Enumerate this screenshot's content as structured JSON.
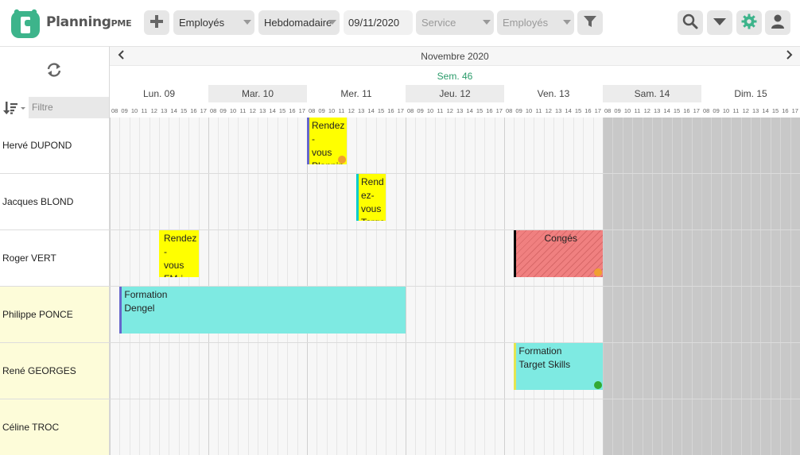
{
  "app": {
    "brand_main": "Planning",
    "brand_suffix": "PME",
    "colors": {
      "accent": "#2a9b6a",
      "logo": "#3db48b"
    }
  },
  "toolbar": {
    "add_icon": "plus-icon",
    "resource_select": "Employés",
    "view_select": "Hebdomadaire",
    "date_value": "09/11/2020",
    "service_select": "Service",
    "employees_select": "Employés",
    "filter_icon": "funnel-icon",
    "search_icon": "search-icon",
    "dropdown_icon": "triangle-down-icon",
    "settings_icon": "gear-icon",
    "user_icon": "user-icon"
  },
  "sidebar": {
    "refresh_icon": "refresh-icon",
    "sort_icon": "sort-icon",
    "filter_placeholder": "Filtre",
    "employees": [
      {
        "name": "Hervé DUPOND",
        "highlight": false
      },
      {
        "name": "Jacques BLOND",
        "highlight": false
      },
      {
        "name": "Roger VERT",
        "highlight": false
      },
      {
        "name": "Philippe PONCE",
        "highlight": true
      },
      {
        "name": "René GEORGES",
        "highlight": true
      },
      {
        "name": "Céline TROC",
        "highlight": true
      }
    ]
  },
  "calendar": {
    "prev_icon": "chevron-left-icon",
    "next_icon": "chevron-right-icon",
    "month": "Novembre 2020",
    "week": "Sem. 46",
    "days": [
      {
        "label": "Lun. 09",
        "weekend": false
      },
      {
        "label": "Mar. 10",
        "weekend": false
      },
      {
        "label": "Mer. 11",
        "weekend": false
      },
      {
        "label": "Jeu. 12",
        "weekend": false
      },
      {
        "label": "Ven. 13",
        "weekend": false
      },
      {
        "label": "Sam. 14",
        "weekend": true
      },
      {
        "label": "Dim. 15",
        "weekend": true
      }
    ],
    "hours": [
      "08",
      "09",
      "10",
      "11",
      "12",
      "13",
      "14",
      "15",
      "16",
      "17"
    ],
    "events": [
      {
        "row": 0,
        "day": 2,
        "start": 8,
        "end": 12,
        "text": "Rendez-\nvous\nPlanning\nCongés",
        "bg": "#ffff00",
        "bar": "#6666cc",
        "icon": "#f0a030"
      },
      {
        "row": 1,
        "day": 2,
        "start": 13,
        "end": 16,
        "text": "Rendez-\nvous\nTarget\nSkills",
        "bg": "#ffff00",
        "bar": "#00cccc",
        "icon": ""
      },
      {
        "row": 2,
        "day": 0,
        "start": 13,
        "end": 17,
        "text": "Rendez-\nvous\nFM-i",
        "bg": "#ffff00",
        "bar": "#ffff00",
        "icon": ""
      },
      {
        "row": 2,
        "day": 4,
        "start": 9,
        "end": 18,
        "text": "Congés",
        "bg": "#f08080",
        "bar": "#000000",
        "icon": "#f0a030",
        "hatched": true,
        "center": true
      },
      {
        "row": 3,
        "day": 0,
        "start": 9,
        "end": 18,
        "days": 3,
        "text": "Formation\nDengel",
        "bg": "#7eeae2",
        "bar": "#6666cc",
        "icon": ""
      },
      {
        "row": 4,
        "day": 4,
        "start": 9,
        "end": 18,
        "text": "Formation\nTarget Skills",
        "bg": "#7eeae2",
        "bar": "#e5e550",
        "icon": "#33aa33"
      }
    ]
  }
}
